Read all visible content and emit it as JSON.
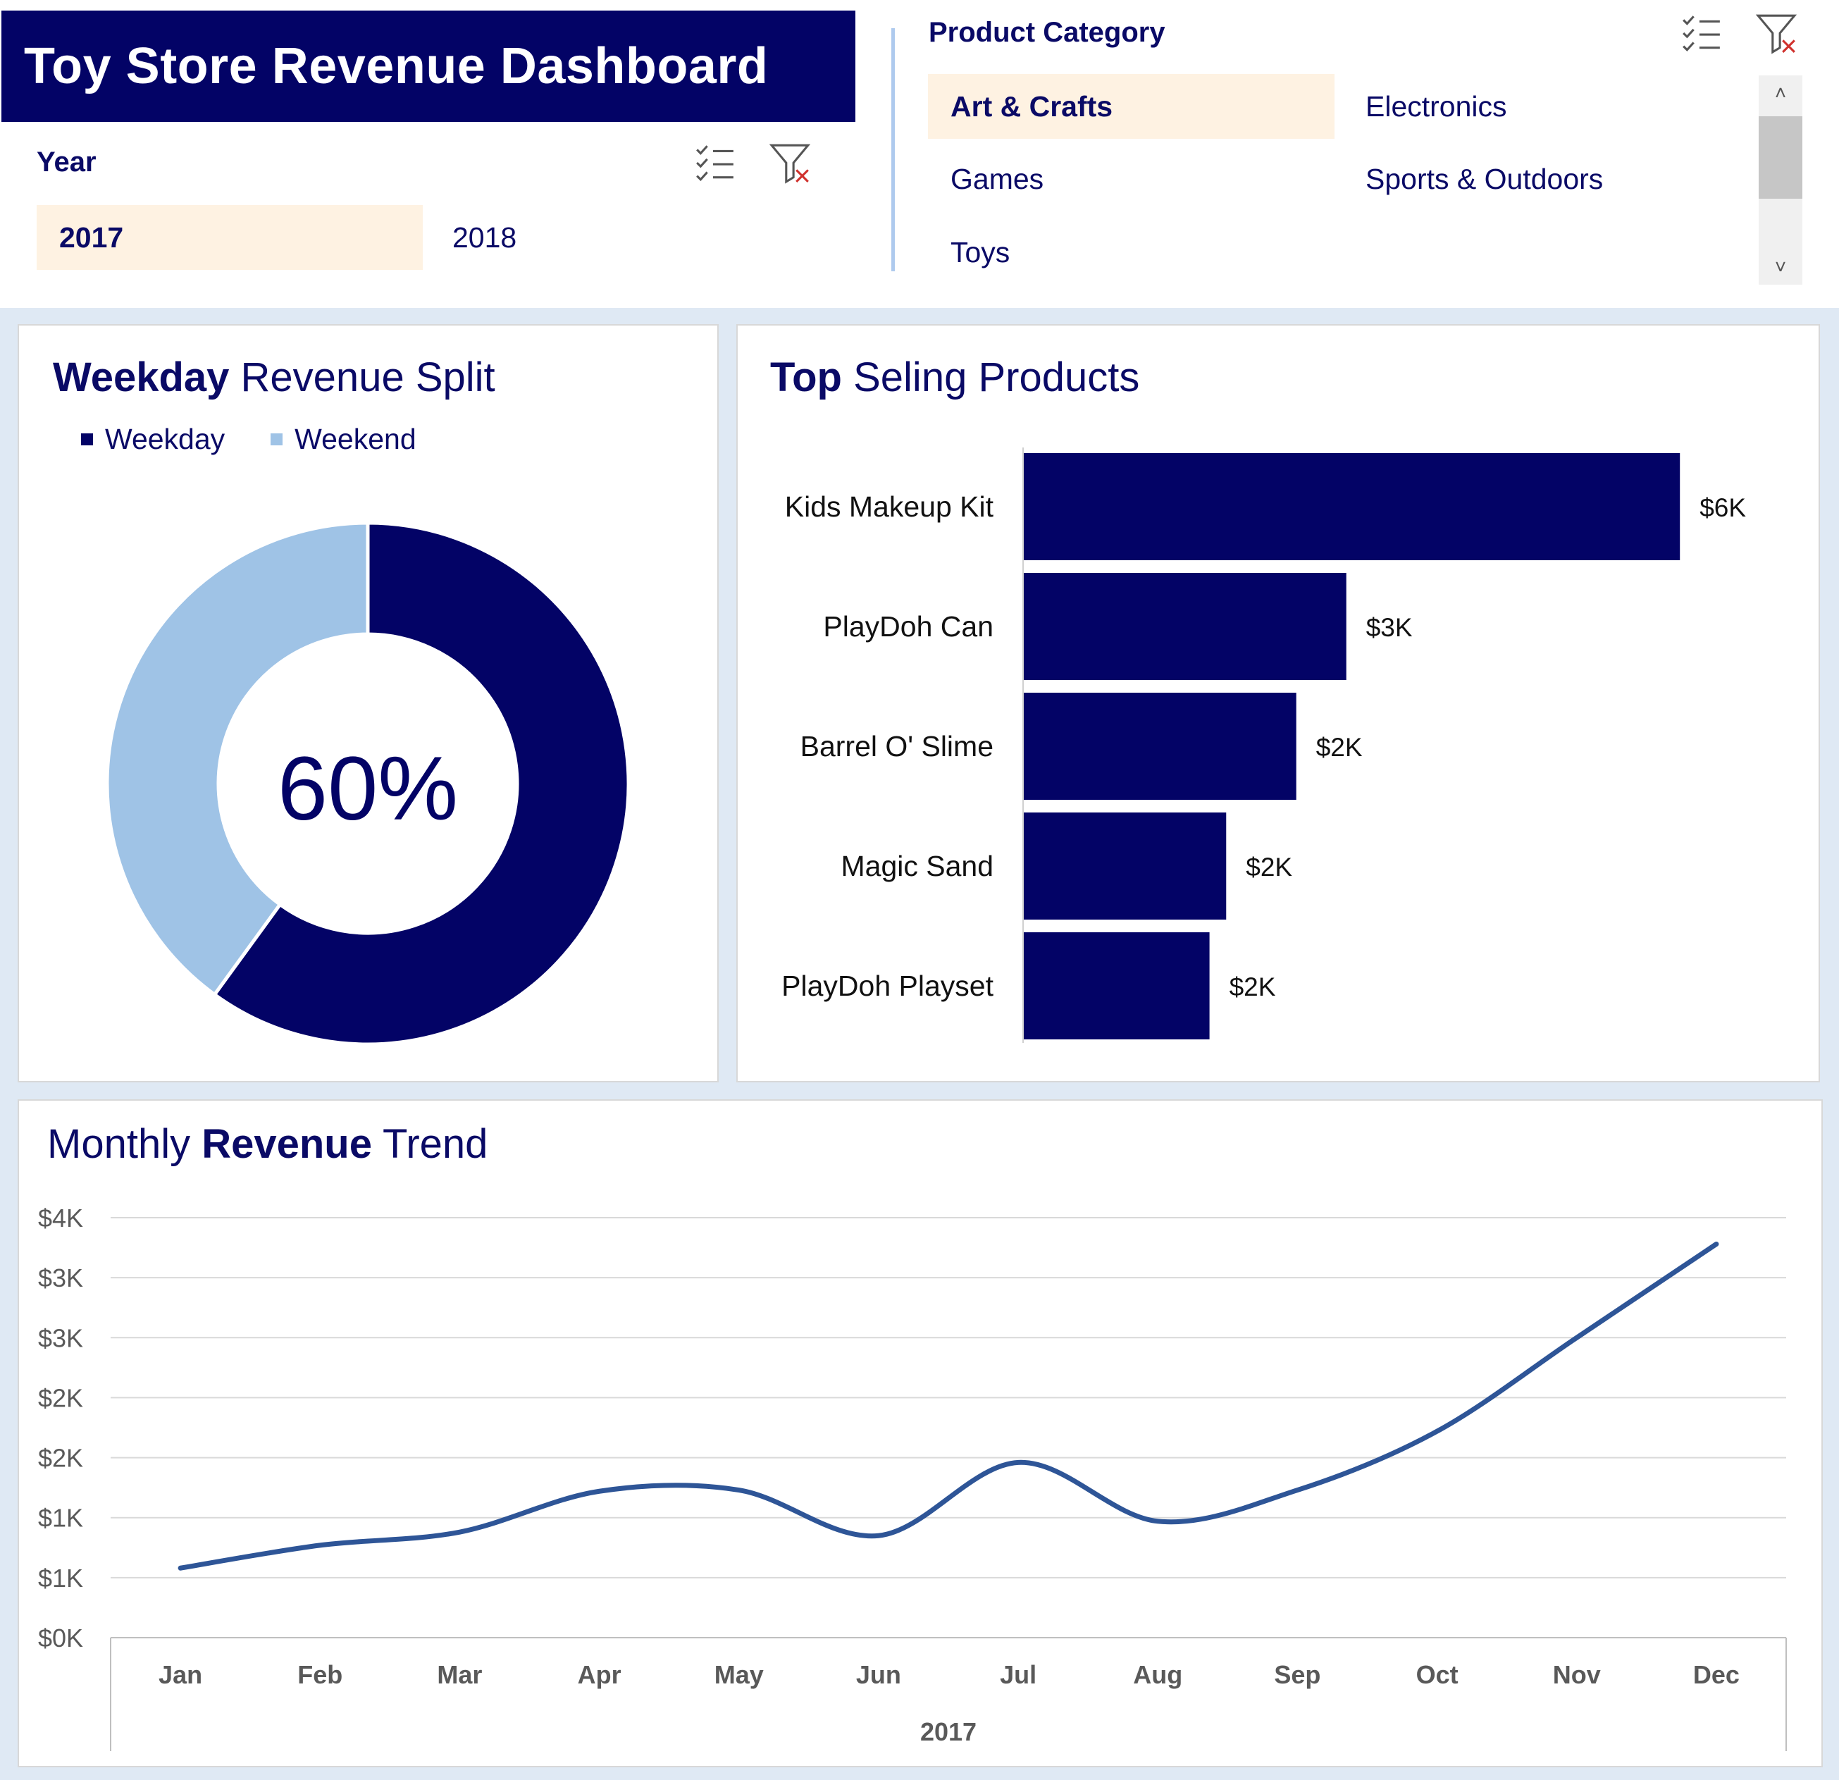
{
  "header": {
    "title": "Toy Store Revenue Dashboard"
  },
  "year_slicer": {
    "label": "Year",
    "items": [
      {
        "label": "2017",
        "selected": true
      },
      {
        "label": "2018",
        "selected": false
      }
    ],
    "multiselect_icon": "multi-select-icon",
    "clear_filter_icon": "clear-filter-icon"
  },
  "category_slicer": {
    "label": "Product Category",
    "items": [
      {
        "label": "Art & Crafts",
        "selected": true
      },
      {
        "label": "Electronics",
        "selected": false
      },
      {
        "label": "Games",
        "selected": false
      },
      {
        "label": "Sports & Outdoors",
        "selected": false
      },
      {
        "label": "Toys",
        "selected": false
      }
    ],
    "scroll_up": "˄",
    "scroll_down": "˅"
  },
  "weekday_card": {
    "title_bold": "Weekday",
    "title_rest": " Revenue Split",
    "center_label": "60%",
    "legend": [
      {
        "label": "Weekday",
        "color": "#030366"
      },
      {
        "label": "Weekend",
        "color": "#9fc3e6"
      }
    ]
  },
  "top_products_card": {
    "title_bold": "Top",
    "title_rest": " Seling Products"
  },
  "monthly_card": {
    "title_pre": "Monthly ",
    "title_bold": "Revenue",
    "title_post": " Trend"
  },
  "chart_data": [
    {
      "type": "pie",
      "variant": "donut",
      "categories": [
        "Weekday",
        "Weekend"
      ],
      "values": [
        60,
        40
      ],
      "colors": [
        "#030366",
        "#9fc3e6"
      ],
      "legend_position": "top-left"
    },
    {
      "type": "bar",
      "orientation": "horizontal",
      "categories": [
        "Kids Makeup Kit",
        "PlayDoh Can",
        "Barrel O' Slime",
        "Magic Sand",
        "PlayDoh Playset"
      ],
      "values": [
        5900,
        2900,
        2450,
        1820,
        1670
      ],
      "data_labels": [
        "$6K",
        "$3K",
        "$2K",
        "$2K",
        "$2K"
      ],
      "xlim": [
        0,
        6000
      ],
      "color": "#030366"
    },
    {
      "type": "line",
      "categories": [
        "Jan",
        "Feb",
        "Mar",
        "Apr",
        "May",
        "Jun",
        "Jul",
        "Aug",
        "Sep",
        "Oct",
        "Nov",
        "Dec"
      ],
      "group_label": "2017",
      "series": [
        {
          "values": [
            580,
            770,
            880,
            1220,
            1230,
            850,
            1460,
            970,
            1230,
            1720,
            2500,
            3280
          ],
          "color": "#2e5597"
        }
      ],
      "ylim": [
        0,
        3500
      ],
      "y_tick_values": [
        0,
        500,
        1000,
        1500,
        2000,
        2500,
        3000,
        3500
      ],
      "y_tick_labels": [
        "$0K",
        "$1K",
        "$1K",
        "$2K",
        "$2K",
        "$3K",
        "$3K",
        "$4K"
      ],
      "grid": true
    }
  ]
}
